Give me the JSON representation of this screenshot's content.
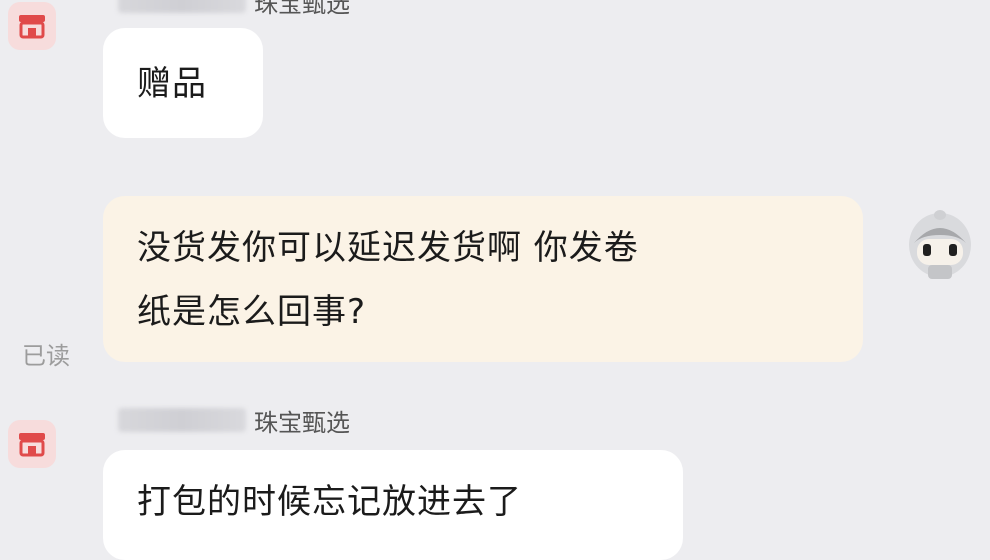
{
  "messages": [
    {
      "sender_shop": "珠宝甄选",
      "text": "赠品"
    },
    {
      "text_line1": "没货发你可以延迟发货啊 你发卷",
      "text_line2": "纸是怎么回事?",
      "read_status": "已读"
    },
    {
      "sender_shop": "珠宝甄选",
      "text": "打包的时候忘记放进去了"
    }
  ],
  "icons": {
    "shop_avatar": "storefront-icon",
    "user_avatar": "cartoon-avatar-icon"
  },
  "colors": {
    "background": "#ededf0",
    "incoming_bubble": "#ffffff",
    "outgoing_bubble": "#fbf3e6",
    "shop_avatar_bg": "#f7dcdc",
    "shop_avatar_icon": "#e04a4a"
  }
}
